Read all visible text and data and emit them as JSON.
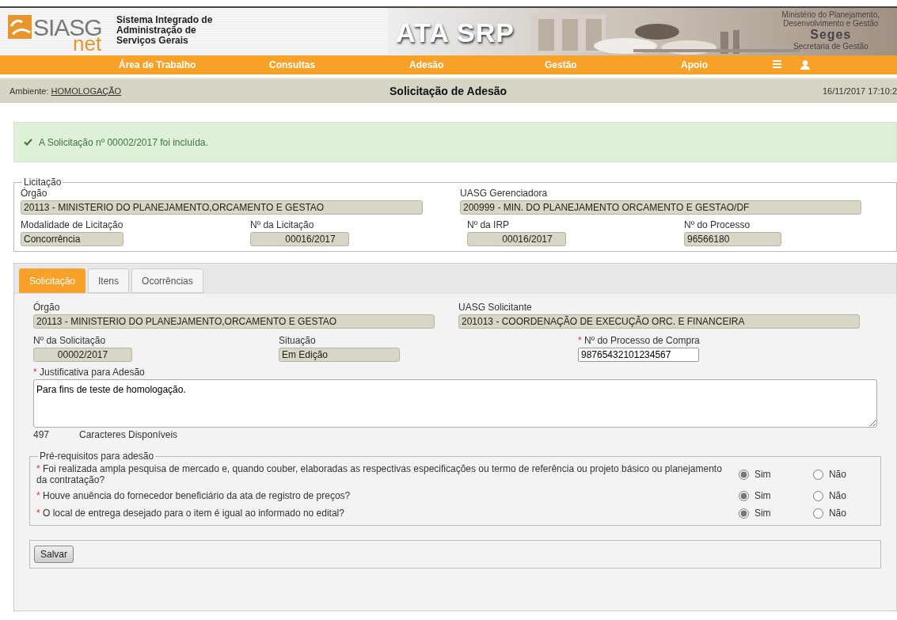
{
  "header": {
    "logo": {
      "mark": "SIASG",
      "sub": "net"
    },
    "system_name": [
      "Sistema Integrado de",
      "Administração de",
      "Serviços Gerais"
    ],
    "banner_title": "ATA SRP",
    "ministry": [
      "Ministério do Planejamento,",
      "Desenvolvimento e Gestão"
    ],
    "unit": "Seges",
    "unit_name": "Secretaria de Gestão"
  },
  "nav": {
    "items": [
      "Área de Trabalho",
      "Consultas",
      "Adesão",
      "Gestão",
      "Apoio"
    ]
  },
  "context_bar": {
    "label": "Ambiente:",
    "environment": "HOMOLOGAÇÃO",
    "title": "Solicitação de Adesão",
    "datetime": "16/11/2017 17:10:2"
  },
  "alert": {
    "text": "A Solicitação nº 00002/2017 foi incluída."
  },
  "licitacao": {
    "legend": "Licitação",
    "fields": [
      {
        "label": "Órgão",
        "value": "20113 - MINISTERIO DO PLANEJAMENTO,ORCAMENTO E GESTAO"
      },
      {
        "label": "UASG Gerenciadora",
        "value": "200999 - MIN. DO PLANEJAMENTO ORCAMENTO E GESTAO/DF"
      },
      {
        "label": "Modalidade de Licitação",
        "value": "Concorrência"
      },
      {
        "label": "Nº da Licitação",
        "value": "00016/2017"
      },
      {
        "label": "Nº da IRP",
        "value": "00016/2017"
      },
      {
        "label": "Nº do Processo",
        "value": "96566180"
      }
    ]
  },
  "tabs": [
    {
      "label": "Solicitação",
      "selected": true
    },
    {
      "label": "Itens",
      "selected": false
    },
    {
      "label": "Ocorrências",
      "selected": false
    }
  ],
  "solicitacao": {
    "fields": [
      {
        "kind": "readonly",
        "label": "Órgão",
        "value": "20113 - MINISTERIO DO PLANEJAMENTO,ORCAMENTO E GESTAO"
      },
      {
        "kind": "readonly",
        "label": "UASG Solicitante",
        "value": "201013 - COORDENAÇÃO DE EXECUÇÃO ORC. E FINANCEIRA"
      },
      {
        "kind": "readonly",
        "label": "Nº da Solicitação",
        "value": "00002/2017"
      },
      {
        "kind": "readonly",
        "label": "Situação",
        "value": "Em Edição"
      },
      {
        "kind": "input",
        "required_mark": "*",
        "label": "Nº do Processo de Compra",
        "value": "98765432101234567"
      }
    ],
    "justificativa": {
      "required_mark": "*",
      "label": "Justificativa para Adesão",
      "value": "Para fins de teste de homologação."
    },
    "counter": {
      "value": "497",
      "label": "Caracteres Disponíveis"
    }
  },
  "prerequisites": {
    "legend": "Pré-requisitos para adesão",
    "questions": [
      {
        "required_mark": "*",
        "text": "Foi realizada ampla pesquisa de mercado e, quando couber, elaboradas as respectivas especificações ou termo de referência ou projeto básico ou planejamento da contratação?",
        "options": [
          {
            "label": "Sim",
            "selected": true
          },
          {
            "label": "Não",
            "selected": false
          }
        ]
      },
      {
        "required_mark": "*",
        "text": "Houve anuência do fornecedor beneficiário da ata de registro de preços?",
        "options": [
          {
            "label": "Sim",
            "selected": true
          },
          {
            "label": "Não",
            "selected": false
          }
        ]
      },
      {
        "required_mark": "*",
        "text": "O local de entrega desejado para o item é igual ao informado no edital?",
        "options": [
          {
            "label": "Sim",
            "selected": true
          },
          {
            "label": "Não",
            "selected": false
          }
        ]
      }
    ]
  },
  "save_button": "Salvar"
}
